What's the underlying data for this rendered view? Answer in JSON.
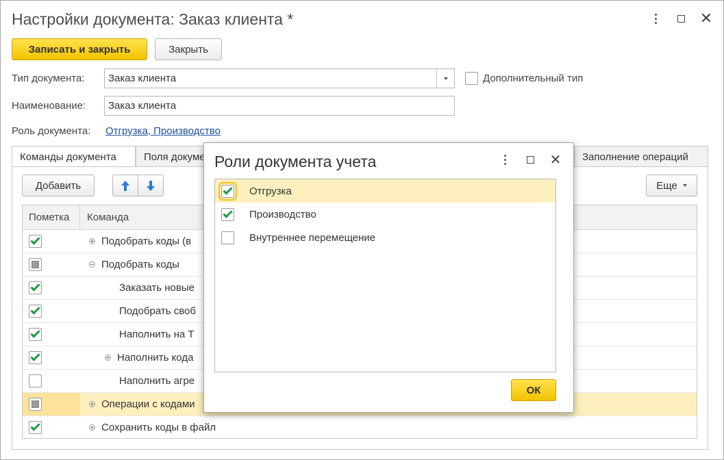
{
  "window": {
    "title": "Настройки документа: Заказ клиента *"
  },
  "toolbar": {
    "save_close_label": "Записать и закрыть",
    "close_label": "Закрыть"
  },
  "form": {
    "doc_type_label": "Тип документа:",
    "doc_type_value": "Заказ клиента",
    "extra_type_label": "Дополнительный тип",
    "extra_type_checked": false,
    "name_label": "Наименование:",
    "name_value": "Заказ клиента",
    "role_label": "Роль документа:",
    "role_value": "Отгрузка, Производство"
  },
  "tabs": [
    {
      "label": "Команды документа",
      "active": true
    },
    {
      "label": "Поля документа",
      "active": false
    },
    {
      "label": "Заполнение операций",
      "active": false
    }
  ],
  "commands_toolbar": {
    "add_label": "Добавить",
    "more_label": "Еще"
  },
  "grid": {
    "columns": [
      "Пометка",
      "Команда"
    ],
    "rows": [
      {
        "mark": "checked",
        "expander": "plus",
        "indent": 1,
        "label": "Подобрать коды (в"
      },
      {
        "mark": "partial",
        "expander": "minus",
        "indent": 1,
        "label": "Подобрать коды"
      },
      {
        "mark": "checked",
        "expander": "none",
        "indent": 2,
        "label": "Заказать новые"
      },
      {
        "mark": "checked",
        "expander": "none",
        "indent": 2,
        "label": "Подобрать своб"
      },
      {
        "mark": "checked",
        "expander": "none",
        "indent": 2,
        "label": "Наполнить на Т"
      },
      {
        "mark": "checked",
        "expander": "plus",
        "indent": 2,
        "label": "Наполнить кода"
      },
      {
        "mark": "unchecked",
        "expander": "none",
        "indent": 2,
        "label": "Наполнить агре"
      },
      {
        "mark": "partial",
        "expander": "plus",
        "indent": 1,
        "label": "Операции с кодами",
        "selected": true
      },
      {
        "mark": "checked",
        "expander": "plus",
        "indent": 1,
        "label": "Сохранить коды в файл"
      }
    ]
  },
  "dialog": {
    "title": "Роли документа учета",
    "items": [
      {
        "label": "Отгрузка",
        "checked": true,
        "selected": true
      },
      {
        "label": "Производство",
        "checked": true,
        "selected": false
      },
      {
        "label": "Внутреннее перемещение",
        "checked": false,
        "selected": false
      }
    ],
    "ok_label": "ОК"
  },
  "colors": {
    "accent_yellow": "#f5c800",
    "selection_row": "#fdf0be",
    "check_green": "#1e9a48",
    "link_blue": "#1a4f9c",
    "arrow_blue": "#2b7bd6"
  },
  "icons": {
    "menu": "more-vert-icon",
    "maximize": "maximize-icon",
    "close": "close-icon",
    "move_up": "arrow-up-icon",
    "move_down": "arrow-down-icon",
    "dropdown": "chevron-down-icon"
  }
}
